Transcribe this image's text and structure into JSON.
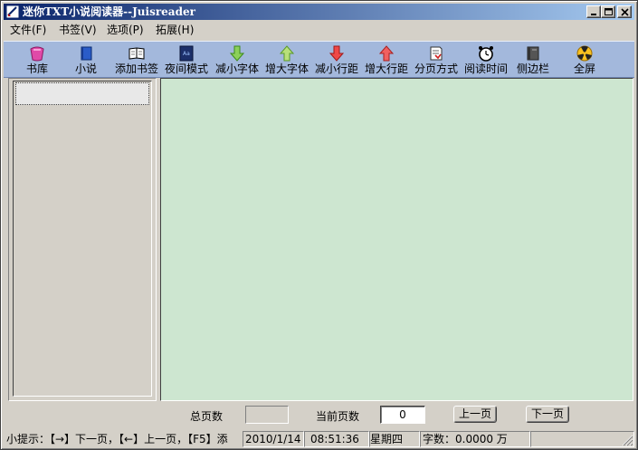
{
  "window": {
    "title": "迷你TXT小说阅读器--Juisreader",
    "controls": [
      "minimize",
      "maximize",
      "close"
    ]
  },
  "menu": [
    {
      "label": "文件(F)"
    },
    {
      "label": "书签(V)"
    },
    {
      "label": "选项(P)"
    },
    {
      "label": "拓展(H)"
    }
  ],
  "toolbar": {
    "items": [
      {
        "label": "书库",
        "icon": "library-icon"
      },
      {
        "label": "小说",
        "icon": "novel-book-icon"
      },
      {
        "label": "添加书签",
        "icon": "add-bookmark-icon"
      },
      {
        "label": "夜间模式",
        "icon": "night-mode-icon"
      },
      {
        "label": "减小字体",
        "icon": "decrease-font-arrow-icon"
      },
      {
        "label": "增大字体",
        "icon": "increase-font-arrow-icon"
      },
      {
        "label": "减小行距",
        "icon": "decrease-line-spacing-arrow-icon"
      },
      {
        "label": "增大行距",
        "icon": "increase-line-spacing-arrow-icon"
      },
      {
        "label": "分页方式",
        "icon": "pagination-icon"
      },
      {
        "label": "阅读时间",
        "icon": "alarm-clock-icon"
      },
      {
        "label": "侧边栏",
        "icon": "sidebar-icon"
      },
      {
        "label": "全屏",
        "icon": "fullscreen-icon"
      }
    ]
  },
  "colors": {
    "reader_background": "#cde6d0",
    "toolbar_background": "#a3b8dc",
    "title_gradient_start": "#0a246a",
    "title_gradient_end": "#a6caf0"
  },
  "pager": {
    "total_pages_label": "总页数",
    "total_pages_value": "",
    "current_page_label": "当前页数",
    "current_page_value": "0",
    "prev_label": "上一页",
    "next_label": "下一页"
  },
  "status": {
    "tip": "小提示：【→】下一页，【←】上一页，【F5】添",
    "date": "2010/1/14",
    "time": "08:51:36",
    "weekday": "星期四",
    "word_count": "字数：0.0000 万"
  }
}
